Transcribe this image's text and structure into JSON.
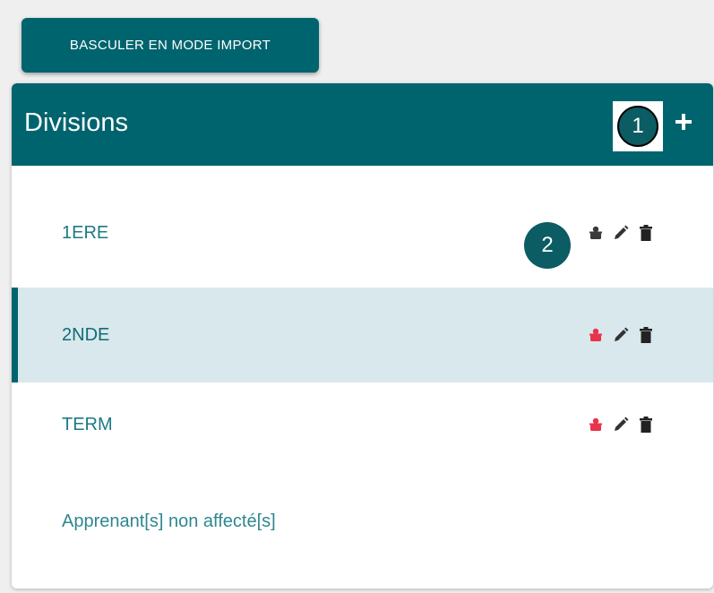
{
  "toolbar": {
    "import_button_label": "BASCULER EN MODE IMPORT"
  },
  "panel": {
    "title": "Divisions",
    "header_step_number": "1",
    "add_icon": "plus-icon"
  },
  "divisions": [
    {
      "label": "1ERE",
      "step_number": "2",
      "user_icon_color": "#3a3a3a",
      "selected": false
    },
    {
      "label": "2NDE",
      "user_icon_color": "#e8334a",
      "selected": true
    },
    {
      "label": "TERM",
      "user_icon_color": "#e8334a",
      "selected": false
    }
  ],
  "unassigned_label": "Apprenant[s] non affecté[s]",
  "colors": {
    "primary": "#00646e",
    "selected_row": "#d9e8ec",
    "link_text": "#1d7a85",
    "alert_icon": "#e8334a",
    "neutral_icon": "#3a3a3a"
  },
  "icons": [
    "user-icon",
    "edit-icon",
    "delete-icon"
  ]
}
